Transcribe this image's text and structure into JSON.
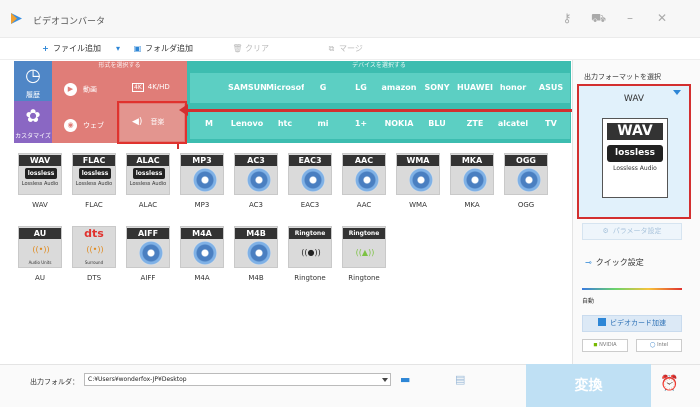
{
  "app": {
    "title": "ビデオコンバータ"
  },
  "toolbar": {
    "add_file": "ファイル追加",
    "add_folder": "フォルダ追加",
    "clear": "クリア",
    "merge": "マージ"
  },
  "categories": {
    "history": "履歴",
    "customize": "カスタマイズ",
    "format_header": "形式を選択する",
    "device_header": "デバイスを選択する",
    "video": "動画",
    "hd": "4K/HD",
    "web": "ウェブ",
    "music": "音楽"
  },
  "devices_row1": [
    "",
    "SAMSUNG",
    "Microsoft",
    "G",
    "LG",
    "amazon",
    "SONY",
    "HUAWEI",
    "honor",
    "ASUS"
  ],
  "devices_row2": [
    "M",
    "Lenovo",
    "htc",
    "mi",
    "1+",
    "NOKIA",
    "BLU",
    "ZTE",
    "alcatel",
    "TV"
  ],
  "formats": [
    {
      "label": "WAV",
      "name": "WAV",
      "kind": "lossless",
      "tag": "lossless",
      "sub": "Lossless Audio"
    },
    {
      "label": "FLAC",
      "name": "FLAC",
      "kind": "lossless",
      "tag": "lossless",
      "sub": "Lossless Audio"
    },
    {
      "label": "ALAC",
      "name": "ALAC",
      "kind": "lossless",
      "tag": "lossless",
      "sub": "Lossless Audio"
    },
    {
      "label": "MP3",
      "name": "MP3",
      "kind": "disc"
    },
    {
      "label": "AC3",
      "name": "AC3",
      "kind": "disc"
    },
    {
      "label": "EAC3",
      "name": "EAC3",
      "kind": "disc"
    },
    {
      "label": "AAC",
      "name": "AAC",
      "kind": "disc"
    },
    {
      "label": "WMA",
      "name": "WMA",
      "kind": "disc"
    },
    {
      "label": "MKA",
      "name": "MKA",
      "kind": "disc"
    },
    {
      "label": "OGG",
      "name": "OGG",
      "kind": "disc"
    },
    {
      "label": "AU",
      "name": "AU",
      "kind": "au",
      "sub": "Audio Units"
    },
    {
      "label": "dts",
      "name": "DTS",
      "kind": "dts",
      "sub": "Surround"
    },
    {
      "label": "AIFF",
      "name": "AIFF",
      "kind": "disc"
    },
    {
      "label": "M4A",
      "name": "M4A",
      "kind": "disc"
    },
    {
      "label": "M4B",
      "name": "M4B",
      "kind": "disc"
    },
    {
      "label": "Ringtone",
      "name": "Ringtone",
      "kind": "ring",
      "os": "apple"
    },
    {
      "label": "Ringtone",
      "name": "Ringtone",
      "kind": "ring",
      "os": "android"
    }
  ],
  "right": {
    "output_label": "出力フォーマットを選択",
    "selected": "WAV",
    "big_label": "WAV",
    "big_tag": "lossless",
    "big_sub": "Lossless Audio",
    "param_button": "パラメータ設定",
    "quick_setting": "クイック設定",
    "auto": "自動",
    "gpu_button": "ビデオカード加速",
    "nvidia": "NVIDIA",
    "intel": "Intel"
  },
  "bottom": {
    "folder_label": "出力フォルダ：",
    "path": "C:¥Users¥wonderfox-JP¥Desktop",
    "convert": "変換"
  },
  "colors": {
    "format_panel": "#e07d78",
    "device_panel": "#3dbdb0",
    "highlight": "#d32f2f"
  }
}
